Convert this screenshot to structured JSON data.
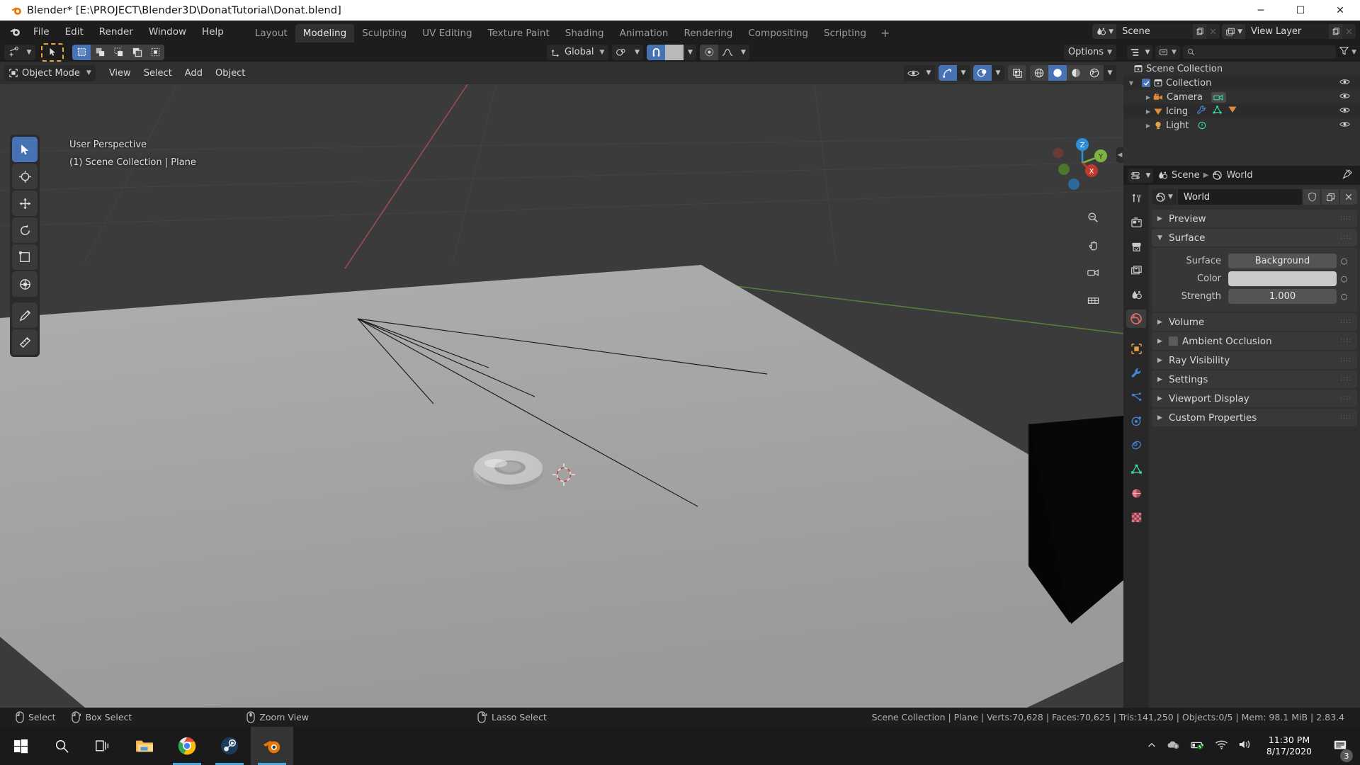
{
  "window": {
    "title": "Blender* [E:\\PROJECT\\Blender3D\\DonatTutorial\\Donat.blend]",
    "minimize": "─",
    "maximize": "☐",
    "close": "✕"
  },
  "topbar": {
    "menus": [
      "File",
      "Edit",
      "Render",
      "Window",
      "Help"
    ],
    "workspaces": [
      {
        "label": "Layout",
        "active": false
      },
      {
        "label": "Modeling",
        "active": true
      },
      {
        "label": "Sculpting",
        "active": false
      },
      {
        "label": "UV Editing",
        "active": false
      },
      {
        "label": "Texture Paint",
        "active": false
      },
      {
        "label": "Shading",
        "active": false
      },
      {
        "label": "Animation",
        "active": false
      },
      {
        "label": "Rendering",
        "active": false
      },
      {
        "label": "Compositing",
        "active": false
      },
      {
        "label": "Scripting",
        "active": false
      }
    ],
    "add_workspace": "+",
    "scene_name": "Scene",
    "view_layer_name": "View Layer"
  },
  "viewport": {
    "header": {
      "mode": "Object Mode",
      "menus": [
        "View",
        "Select",
        "Add",
        "Object"
      ],
      "transform_orientation": "Global",
      "options": "Options"
    },
    "overlay_line1": "User Perspective",
    "overlay_line2": "(1) Scene Collection | Plane",
    "gizmo_axes": {
      "x": "X",
      "y": "Y",
      "z": "Z"
    },
    "tools": [
      "tweak-select-tool",
      "cursor-tool",
      "move-tool",
      "rotate-tool",
      "scale-tool",
      "transform-tool",
      "annotate-tool",
      "measure-tool"
    ],
    "select_modes": [
      "set-select",
      "extend-select",
      "subtract-select",
      "invert-select",
      "intersect-select"
    ]
  },
  "outliner": {
    "search_placeholder": "",
    "rows": [
      {
        "label": "Scene Collection",
        "icon": "collection-icon",
        "indent": 0,
        "tri": "",
        "checkbox": false,
        "extra": [],
        "eye": false
      },
      {
        "label": "Collection",
        "icon": "collection-icon",
        "indent": 1,
        "tri": "▼",
        "checkbox": true,
        "extra": [],
        "eye": true
      },
      {
        "label": "Camera",
        "icon": "camera-icon",
        "indent": 2,
        "tri": "▶",
        "checkbox": false,
        "extra": [
          "camera-data-icon"
        ],
        "eye": true
      },
      {
        "label": "Icing",
        "icon": "mesh-icon",
        "indent": 2,
        "tri": "▶",
        "checkbox": false,
        "extra": [
          "modifier-icon",
          "mesh-data-icon",
          "mesh-icon"
        ],
        "eye": true
      },
      {
        "label": "Light",
        "icon": "light-icon",
        "indent": 2,
        "tri": "▶",
        "checkbox": false,
        "extra": [
          "light-data-icon"
        ],
        "eye": true
      }
    ]
  },
  "properties": {
    "breadcrumb": [
      "Scene",
      "World"
    ],
    "id_name": "World",
    "id_buttons": [
      "shield-icon",
      "duplicate-icon",
      "close-icon"
    ],
    "panels": [
      {
        "label": "Preview",
        "open": false,
        "checkbox": null
      },
      {
        "label": "Surface",
        "open": true,
        "checkbox": null
      },
      {
        "label": "Volume",
        "open": false,
        "checkbox": null
      },
      {
        "label": "Ambient Occlusion",
        "open": false,
        "checkbox": false
      },
      {
        "label": "Ray Visibility",
        "open": false,
        "checkbox": null
      },
      {
        "label": "Settings",
        "open": false,
        "checkbox": null
      },
      {
        "label": "Viewport Display",
        "open": false,
        "checkbox": null
      },
      {
        "label": "Custom Properties",
        "open": false,
        "checkbox": null
      }
    ],
    "surface": {
      "surface_label": "Surface",
      "surface_value": "Background",
      "color_label": "Color",
      "color_value": "",
      "color_hex": "#c9c9c9",
      "strength_label": "Strength",
      "strength_value": "1.000"
    },
    "tabs": [
      "tool-icon",
      "render-icon",
      "output-icon",
      "view-layer-icon",
      "scene-icon",
      "world-icon",
      "object-icon",
      "modifier-icon",
      "particles-icon",
      "physics-icon",
      "constraints-icon",
      "data-icon",
      "material-icon",
      "texture-icon"
    ],
    "active_tab_index": 5
  },
  "statusbar": {
    "hints": [
      {
        "icon": "mouse-left-icon",
        "label": "Select"
      },
      {
        "icon": "mouse-left-drag-icon",
        "label": "Box Select"
      },
      {
        "icon": "mouse-middle-icon",
        "label": "Zoom View"
      },
      {
        "icon": "mouse-right-icon",
        "label": "Lasso Select"
      }
    ],
    "stats": "Scene Collection | Plane | Verts:70,628 | Faces:70,625 | Tris:141,250 | Objects:0/5 | Mem: 98.1 MiB | 2.83.4"
  },
  "taskbar": {
    "items": [
      {
        "name": "start-button",
        "icon": "windows-icon",
        "running": false,
        "active": false
      },
      {
        "name": "search-button",
        "icon": "search-icon",
        "running": false,
        "active": false
      },
      {
        "name": "task-view-button",
        "icon": "task-view-icon",
        "running": false,
        "active": false
      },
      {
        "name": "file-explorer",
        "icon": "folder-icon",
        "running": false,
        "active": false
      },
      {
        "name": "chrome",
        "icon": "chrome-icon",
        "running": true,
        "active": false
      },
      {
        "name": "steam",
        "icon": "steam-icon",
        "running": true,
        "active": false
      },
      {
        "name": "blender",
        "icon": "blender-icon",
        "running": true,
        "active": true
      }
    ],
    "tray": [
      "chevron-up-icon",
      "onedrive-icon",
      "battery-icon",
      "wifi-icon",
      "volume-icon"
    ],
    "clock_time": "11:30 PM",
    "clock_date": "8/17/2020",
    "notification_count": "3"
  },
  "colors": {
    "blender_orange": "#e87d0d",
    "accent_blue": "#4772b3",
    "panel_bg": "#303030",
    "header_bg": "#1d1d1d"
  }
}
